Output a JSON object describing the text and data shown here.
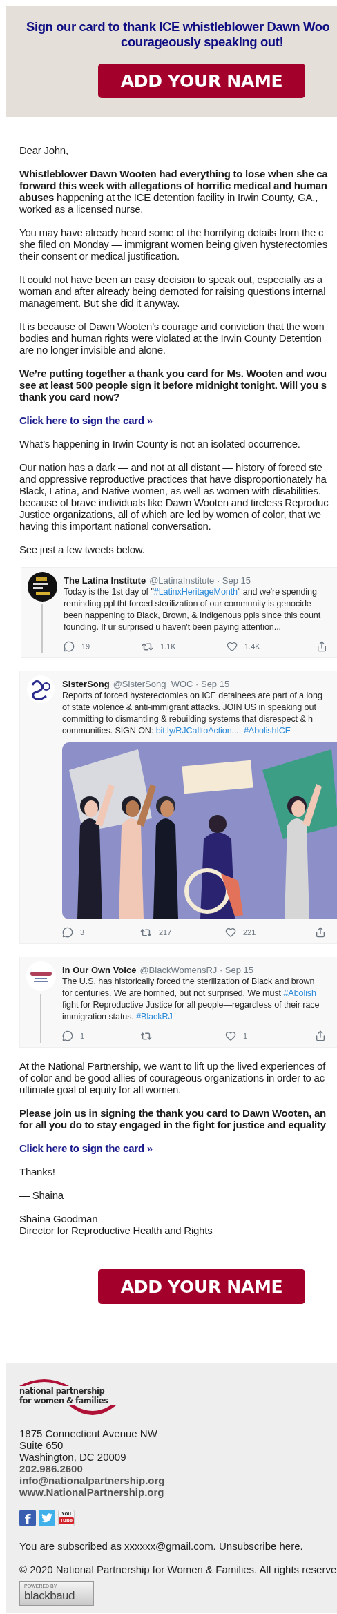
{
  "banner": {
    "title_lines": [
      "Sign our card to thank ICE whistleblower Dawn Woo",
      "courageously speaking out!"
    ],
    "button": "ADD YOUR NAME"
  },
  "intro": [
    {
      "kind": "text",
      "lines": [
        "Dear John,"
      ]
    },
    {
      "kind": "text",
      "lines": [
        "**Whistleblower Dawn Wooten had everything to lose when she ca**",
        "**forward this week with allegations of horrific medical and human**",
        "**abuses** happening at the ICE detention facility in Irwin County, GA.,",
        "worked as a licensed nurse."
      ]
    },
    {
      "kind": "text",
      "lines": [
        "You may have already heard some of the horrifying details from the c",
        "she filed on Monday — immigrant women being given hysterectomies",
        "their consent or medical justification."
      ]
    },
    {
      "kind": "text",
      "lines": [
        "It could not have been an easy decision to speak out, especially as a",
        "woman and after already being demoted for raising questions internal",
        "management. But she did it anyway."
      ]
    },
    {
      "kind": "text",
      "lines": [
        "It is because of Dawn Wooten’s courage and conviction that the wom",
        "bodies and human rights were violated at the Irwin County Detention",
        "are no longer invisible and alone."
      ]
    },
    {
      "kind": "bold",
      "lines": [
        "We’re putting together a thank you card for Ms. Wooten and wou",
        "see at least 500 people sign it before midnight tonight. Will you s",
        "thank you card now?"
      ]
    },
    {
      "kind": "link",
      "lines": [
        "Click here to sign the card »"
      ]
    },
    {
      "kind": "text",
      "lines": [
        "What’s happening in Irwin County is not an isolated occurrence."
      ]
    },
    {
      "kind": "text",
      "lines": [
        "Our nation has a dark — and not at all distant — history of forced ste",
        "and oppressive reproductive practices that have disproportionately ha",
        "Black, Latina, and Native women, as well as women with disabilities.",
        "because of brave individuals like Dawn Wooten and tireless Reproduc",
        "Justice organizations, all of which are led by women of color, that we",
        "having this important national conversation."
      ]
    },
    {
      "kind": "text",
      "lines": [
        "See just a few tweets below."
      ]
    }
  ],
  "tweets": [
    {
      "name": "The Latina Institute",
      "handle": "@LatinaInstitute · Sep 15",
      "thread": true,
      "lines": [
        [
          {
            "kind": "text",
            "text": "Today is the 1st day of \""
          },
          {
            "kind": "tag",
            "text": "#LatinxHeritageMonth"
          },
          {
            "kind": "text",
            "text": "\" and we're spending"
          }
        ],
        [
          {
            "kind": "text",
            "text": "reminding ppl tht forced sterilization of our community is genocide"
          }
        ],
        [
          {
            "kind": "text",
            "text": "been happening to Black, Brown, & Indigenous ppls since this count"
          }
        ],
        [
          {
            "kind": "text",
            "text": "founding. If ur surprised u haven't been paying attention..."
          }
        ]
      ],
      "actions": [
        {
          "kind": "reply",
          "count": "19"
        },
        {
          "kind": "retweet",
          "count": "1.1K"
        },
        {
          "kind": "like",
          "count": "1.4K"
        },
        {
          "kind": "share"
        }
      ]
    },
    {
      "name": "SisterSong",
      "handle": "@SisterSong_WOC · Sep 15",
      "thread": false,
      "lines": [
        [
          {
            "kind": "text",
            "text": "Reports of forced hysterectomies on ICE detainees are part of a long"
          }
        ],
        [
          {
            "kind": "text",
            "text": "of state violence & anti-immigrant attacks. JOIN US in speaking out"
          }
        ],
        [
          {
            "kind": "text",
            "text": "committing to dismantling & rebuilding systems that disrespect & h"
          }
        ],
        [
          {
            "kind": "text",
            "text": "communities. SIGN ON: "
          },
          {
            "kind": "tag",
            "text": "bit.ly/RJCalltoAction...."
          },
          {
            "kind": "tag",
            "text": "#AbolishICE"
          }
        ]
      ],
      "media": {
        "kind": "picture"
      },
      "actions": [
        {
          "kind": "reply",
          "count": "3"
        },
        {
          "kind": "retweet",
          "count": "217"
        },
        {
          "kind": "like",
          "count": "221"
        },
        {
          "kind": "share"
        }
      ]
    },
    {
      "name": "In Our Own Voice",
      "handle": "@BlackWomensRJ · Sep 15",
      "thread": true,
      "lines": [
        [
          {
            "kind": "text",
            "text": "The U.S. has historically forced the sterilization of Black and brown"
          }
        ],
        [
          {
            "kind": "text",
            "text": "for centuries. We are horrified, but not surprised. We must "
          },
          {
            "kind": "tag",
            "text": "#Abolish"
          }
        ],
        [
          {
            "kind": "text",
            "text": "fight for Reproductive Justice for all people—regardless of their race"
          }
        ],
        [
          {
            "kind": "text",
            "text": "immigration status. "
          },
          {
            "kind": "tag",
            "text": "#BlackRJ"
          }
        ]
      ],
      "actions": [
        {
          "kind": "reply",
          "count": "1"
        },
        {
          "kind": "retweet"
        },
        {
          "kind": "like",
          "count": "1"
        },
        {
          "kind": "share"
        }
      ]
    }
  ],
  "closing": [
    {
      "kind": "text",
      "lines": [
        "At the National Partnership, we want to lift up the lived experiences of",
        "of color and be good allies of courageous organizations in order to ac",
        "ultimate goal of equity for all women."
      ]
    },
    {
      "kind": "bold",
      "lines": [
        "Please join us in signing the thank you card to Dawn Wooten, an",
        "for all you do to stay engaged in the fight for justice and equality"
      ]
    },
    {
      "kind": "link",
      "lines": [
        "Click here to sign the card »"
      ]
    },
    {
      "kind": "text",
      "lines": [
        "Thanks!"
      ]
    },
    {
      "kind": "text",
      "lines": [
        "— Shaina"
      ]
    },
    {
      "kind": "text",
      "lines": [
        "Shaina Goodman",
        "Director for Reproductive Health and Rights"
      ]
    }
  ],
  "bottom_button": "ADD YOUR NAME",
  "footer": {
    "logo_lines": [
      "national partnership",
      "for women & families"
    ],
    "address": [
      "1875 Connecticut Avenue NW",
      "Suite 650",
      "Washington, DC 20009"
    ],
    "contacts": [
      "202.986.2600",
      "info@nationalpartnership.org",
      "www.NationalPartnership.org"
    ],
    "social": [
      {
        "kind": "facebook",
        "glyph": "f"
      },
      {
        "kind": "twitter"
      },
      {
        "kind": "youtube",
        "top": "You",
        "bottom": "Tube"
      }
    ],
    "subscription": "You are subscribed as xxxxxx@gmail.com. Unsubscribe here.",
    "copyright": "© 2020 National Partnership for Women & Families. All rights reserve",
    "badge": {
      "small": "POWERED BY",
      "large": "blackbaud"
    }
  }
}
